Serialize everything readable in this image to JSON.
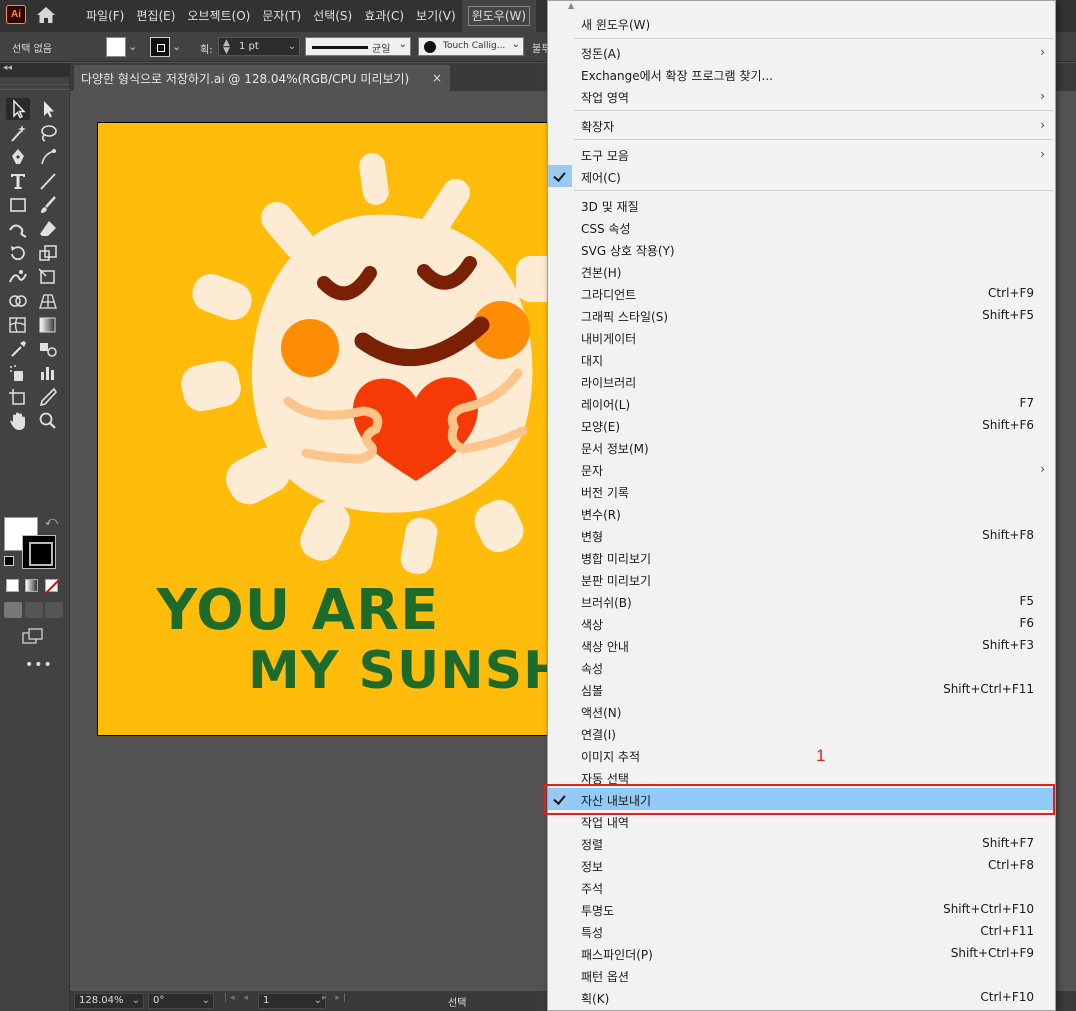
{
  "app": {
    "logo_text": "Ai",
    "menus": [
      "파일(F)",
      "편집(E)",
      "오브젝트(O)",
      "문자(T)",
      "선택(S)",
      "효과(C)",
      "보기(V)",
      "윈도우(W)"
    ],
    "active_menu_index": 7
  },
  "control_bar": {
    "selection_state": "선택 없음",
    "stroke_label": "획:",
    "stroke_width": "1 pt",
    "stroke_profile": "균일",
    "brush_name": "Touch Callig...",
    "opacity_label": "불투"
  },
  "document": {
    "tab_title": "다양한 형식으로 저장하기.ai @ 128.04%(RGB/CPU 미리보기)",
    "tab_close": "×"
  },
  "artwork": {
    "text_line1": "YOU ARE",
    "text_line2": "MY SUNSHINE",
    "colors": {
      "background": "#ffbc0a",
      "sun": "#fdebd3",
      "text": "#1d6b2b",
      "heart": "#f53a06",
      "cheek": "#ff8c05",
      "mouth": "#7a2005"
    }
  },
  "status_bar": {
    "zoom": "128.04%",
    "rotation": "0°",
    "artboard_number": "1",
    "status": "선택"
  },
  "window_menu": {
    "items": [
      {
        "label": "새 윈도우(W)",
        "shortcut": "",
        "submenu": false,
        "checked": false
      },
      {
        "label": "정돈(A)",
        "shortcut": "",
        "submenu": true,
        "checked": false
      },
      {
        "label": "Exchange에서 확장 프로그램 찾기...",
        "shortcut": "",
        "submenu": false,
        "checked": false
      },
      {
        "label": "작업 영역",
        "shortcut": "",
        "submenu": true,
        "checked": false
      },
      {
        "label": "확장자",
        "shortcut": "",
        "submenu": true,
        "checked": false
      },
      {
        "label": "도구 모음",
        "shortcut": "",
        "submenu": true,
        "checked": false
      },
      {
        "label": "제어(C)",
        "shortcut": "",
        "submenu": false,
        "checked": true
      },
      {
        "label": "3D 및 재질",
        "shortcut": "",
        "submenu": false,
        "checked": false
      },
      {
        "label": "CSS 속성",
        "shortcut": "",
        "submenu": false,
        "checked": false
      },
      {
        "label": "SVG 상호 작용(Y)",
        "shortcut": "",
        "submenu": false,
        "checked": false
      },
      {
        "label": "견본(H)",
        "shortcut": "",
        "submenu": false,
        "checked": false
      },
      {
        "label": "그라디언트",
        "shortcut": "Ctrl+F9",
        "submenu": false,
        "checked": false
      },
      {
        "label": "그래픽 스타일(S)",
        "shortcut": "Shift+F5",
        "submenu": false,
        "checked": false
      },
      {
        "label": "내비게이터",
        "shortcut": "",
        "submenu": false,
        "checked": false
      },
      {
        "label": "대지",
        "shortcut": "",
        "submenu": false,
        "checked": false
      },
      {
        "label": "라이브러리",
        "shortcut": "",
        "submenu": false,
        "checked": false
      },
      {
        "label": "레이어(L)",
        "shortcut": "F7",
        "submenu": false,
        "checked": false
      },
      {
        "label": "모양(E)",
        "shortcut": "Shift+F6",
        "submenu": false,
        "checked": false
      },
      {
        "label": "문서 정보(M)",
        "shortcut": "",
        "submenu": false,
        "checked": false
      },
      {
        "label": "문자",
        "shortcut": "",
        "submenu": true,
        "checked": false
      },
      {
        "label": "버전 기록",
        "shortcut": "",
        "submenu": false,
        "checked": false
      },
      {
        "label": "변수(R)",
        "shortcut": "",
        "submenu": false,
        "checked": false
      },
      {
        "label": "변형",
        "shortcut": "Shift+F8",
        "submenu": false,
        "checked": false
      },
      {
        "label": "병합 미리보기",
        "shortcut": "",
        "submenu": false,
        "checked": false
      },
      {
        "label": "분판 미리보기",
        "shortcut": "",
        "submenu": false,
        "checked": false
      },
      {
        "label": "브러쉬(B)",
        "shortcut": "F5",
        "submenu": false,
        "checked": false
      },
      {
        "label": "색상",
        "shortcut": "F6",
        "submenu": false,
        "checked": false
      },
      {
        "label": "색상 안내",
        "shortcut": "Shift+F3",
        "submenu": false,
        "checked": false
      },
      {
        "label": "속성",
        "shortcut": "",
        "submenu": false,
        "checked": false
      },
      {
        "label": "심볼",
        "shortcut": "Shift+Ctrl+F11",
        "submenu": false,
        "checked": false
      },
      {
        "label": "액션(N)",
        "shortcut": "",
        "submenu": false,
        "checked": false
      },
      {
        "label": "연결(I)",
        "shortcut": "",
        "submenu": false,
        "checked": false
      },
      {
        "label": "이미지 추적",
        "shortcut": "",
        "submenu": false,
        "checked": false
      },
      {
        "label": "자동 선택",
        "shortcut": "",
        "submenu": false,
        "checked": false
      },
      {
        "label": "자산 내보내기",
        "shortcut": "",
        "submenu": false,
        "checked": true,
        "highlighted": true
      },
      {
        "label": "작업 내역",
        "shortcut": "",
        "submenu": false,
        "checked": false
      },
      {
        "label": "정렬",
        "shortcut": "Shift+F7",
        "submenu": false,
        "checked": false
      },
      {
        "label": "정보",
        "shortcut": "Ctrl+F8",
        "submenu": false,
        "checked": false
      },
      {
        "label": "주석",
        "shortcut": "",
        "submenu": false,
        "checked": false
      },
      {
        "label": "투명도",
        "shortcut": "Shift+Ctrl+F10",
        "submenu": false,
        "checked": false
      },
      {
        "label": "특성",
        "shortcut": "Ctrl+F11",
        "submenu": false,
        "checked": false
      },
      {
        "label": "패스파인더(P)",
        "shortcut": "Shift+Ctrl+F9",
        "submenu": false,
        "checked": false
      },
      {
        "label": "패턴 옵션",
        "shortcut": "",
        "submenu": false,
        "checked": false
      },
      {
        "label": "획(K)",
        "shortcut": "Ctrl+F10",
        "submenu": false,
        "checked": false
      }
    ]
  },
  "annotation": {
    "number": "1",
    "color": "#e0201c"
  }
}
